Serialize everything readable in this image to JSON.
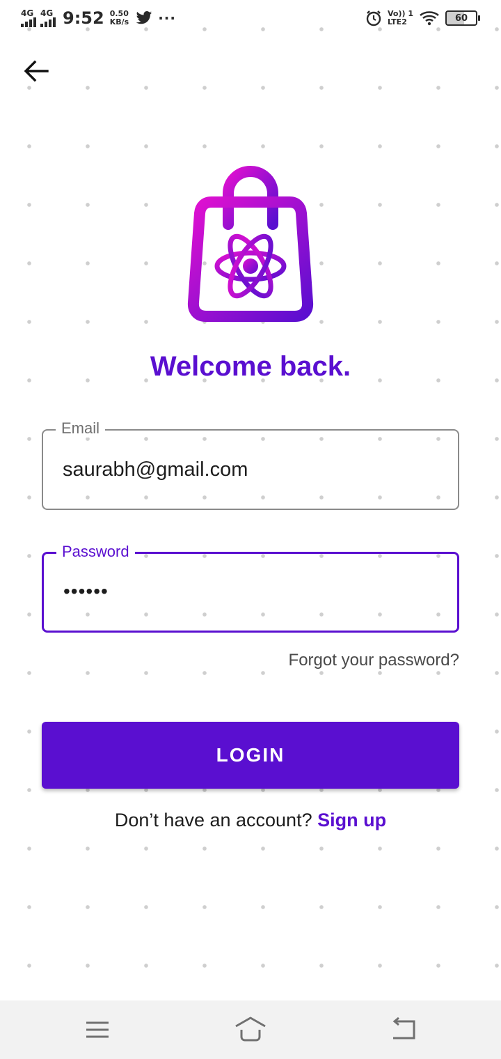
{
  "status_bar": {
    "sim1": "4G",
    "sim2": "4G",
    "time": "9:52",
    "net_speed_value": "0.50",
    "net_speed_unit": "KB/s",
    "more": "···",
    "volte_top": "Vo)) 1",
    "volte_bottom": "LTE2",
    "battery": "60"
  },
  "header": {
    "back_icon": "arrow-left-icon"
  },
  "logo": {
    "icon": "shopping-bag-react-atom-icon",
    "gradient_start": "#e010d0",
    "gradient_end": "#5a0fd0"
  },
  "title": "Welcome back.",
  "form": {
    "email": {
      "label": "Email",
      "value": "saurabh@gmail.com"
    },
    "password": {
      "label": "Password",
      "value": "••••••"
    },
    "forgot_link": "Forgot your password?",
    "login_button": "LOGIN"
  },
  "signup": {
    "prompt": "Don’t have an account?",
    "link": "Sign up"
  },
  "nav_bar": {
    "menu_icon": "menu-icon",
    "home_icon": "home-icon",
    "back_icon": "back-icon"
  },
  "colors": {
    "primary": "#5a0fd0",
    "background": "#ffffff",
    "dot_pattern": "#cfcfcf"
  }
}
